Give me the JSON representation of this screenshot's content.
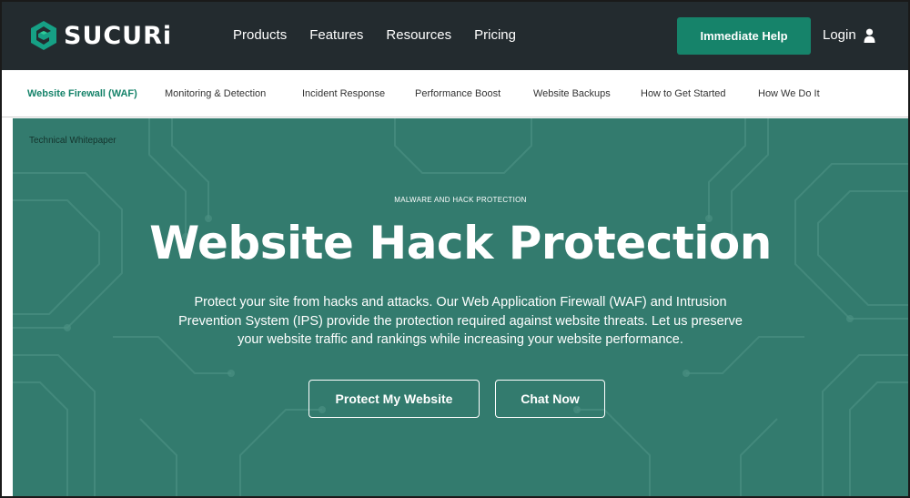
{
  "brand": {
    "name": "SUCURi",
    "accent": "#16836a"
  },
  "main_nav": [
    "Products",
    "Features",
    "Resources",
    "Pricing"
  ],
  "cta": {
    "help_label": "Immediate Help",
    "login_label": "Login"
  },
  "sub_nav": {
    "items": [
      "Website Firewall (WAF)",
      "Monitoring & Detection",
      "Incident Response",
      "Performance Boost",
      "Website Backups",
      "How to Get Started",
      "How We Do It"
    ],
    "active": "Website Firewall (WAF)"
  },
  "hero": {
    "breadcrumb": "Technical Whitepaper",
    "eyebrow": "MALWARE AND HACK PROTECTION",
    "title": "Website Hack Protection",
    "description": "Protect your site from hacks and attacks. Our Web Application Firewall (WAF) and Intrusion Prevention System (IPS) provide the protection required against website threats. Let us preserve your website traffic and rankings while increasing your website performance.",
    "primary_button": "Protect My Website",
    "secondary_button": "Chat Now",
    "background_color": "#337b6e"
  },
  "icons": {
    "logo": "sucuri-logo-icon",
    "login": "user-icon"
  }
}
